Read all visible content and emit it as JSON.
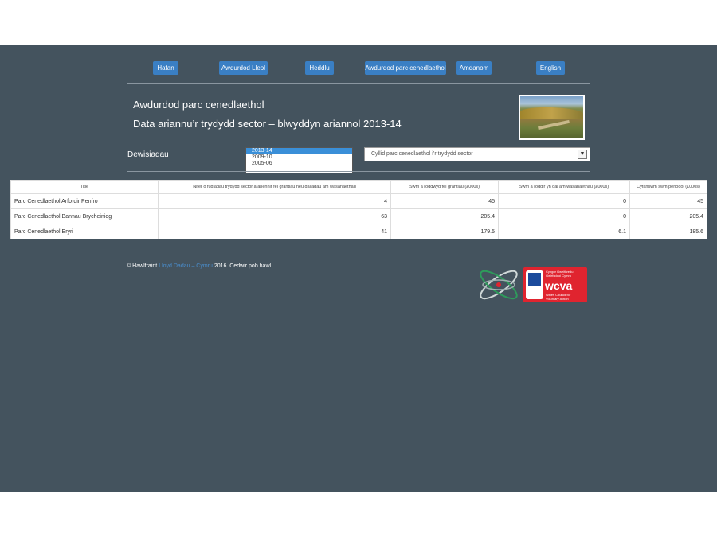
{
  "nav": {
    "items": [
      {
        "label": "Hafan"
      },
      {
        "label": "Awdurdod Lleol"
      },
      {
        "label": "Heddlu"
      },
      {
        "label": "Awdurdod parc cenedlaethol"
      },
      {
        "label": "Amdanom"
      },
      {
        "label": "English"
      }
    ]
  },
  "header": {
    "title": "Awdurdod parc cenedlaethol",
    "subtitle": "Data ariannu’r trydydd sector – blwyddyn ariannol 2013-14"
  },
  "options": {
    "label": "Dewisiadau",
    "years": [
      "2013-14",
      "2009-10",
      "2005-06"
    ],
    "selected_year": "2013-14",
    "select_value": "Cyllid parc cenedlaethol i’r trydydd sector"
  },
  "table": {
    "headers": [
      "Title",
      "Nifer o fudiadau trydydd sector a ariennir fel grantiau neu daliadau am wasanaethau",
      "Swm a roddwyd fel grantiau (£000s)",
      "Swm a roddir yn dâl am wasanaethau (£000s)",
      "Cyfanswm swm penodol (£000s)"
    ],
    "rows": [
      [
        "Parc Cenedlaethol Arfordir Penfro",
        "4",
        "45",
        "0",
        "45"
      ],
      [
        "Parc Cenedlaethol Bannau Brycheiniog",
        "63",
        "205.4",
        "0",
        "205.4"
      ],
      [
        "Parc Cenedlaethol Eryri",
        "41",
        "179.5",
        "6.1",
        "185.6"
      ]
    ]
  },
  "footer": {
    "prefix": "© Hawlfraint",
    "link": "Lloyd Dadau – Cymru",
    "suffix": "2016. Cedwir pob hawl"
  },
  "logos": {
    "wcva_text": "wcva",
    "wcva_line1": "Cyngor Gweithredu",
    "wcva_line2": "Gwirfoddol Cymru",
    "wcva_line3": "Wales Council for",
    "wcva_line4": "Voluntary Action"
  },
  "colors": {
    "background": "#44535e",
    "nav_button": "#3a7fc4",
    "accent_red": "#e0242f"
  }
}
